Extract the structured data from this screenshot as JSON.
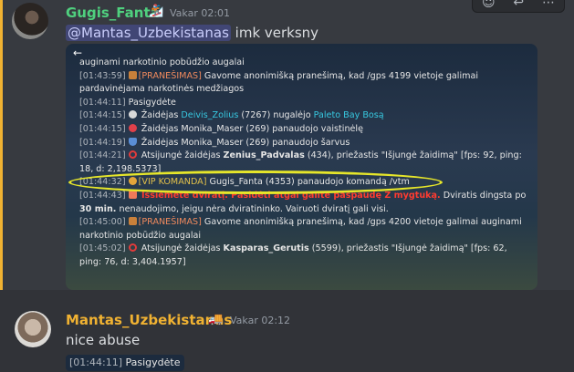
{
  "colors": {
    "highlight_border": "#f0b232",
    "author1": "#4fd07e",
    "author2": "#f0b232",
    "mention_bg": "#5865f2"
  },
  "toolbar": {
    "icons": [
      "emoji-icon",
      "reply-icon",
      "more-icon"
    ]
  },
  "message1": {
    "author": "Gugis_Fanta",
    "badge": "🏂",
    "timestamp": "Vakar 02:01",
    "mention": "@Mantas_Uzbekistanas",
    "text": " imk verksny",
    "screenshot": {
      "rows": [
        {
          "time": "",
          "parts": [
            "auginami narkotinio pobūdžio augalai"
          ]
        },
        {
          "time": "[01:43:59]",
          "tag": "[PRANEŠIMAS]",
          "text": " Gavome anonimišką pranešimą, kad /gps 4199 vietoje galimai pardavinėjama narkotinės medžiagos"
        },
        {
          "time": "[01:44:11]",
          "text": " Pasigydėte"
        },
        {
          "time": "[01:44:15]",
          "pre": " Žaidėjas ",
          "name1": "Deivis_Zolius",
          "mid": " (7267) nugalėjo ",
          "name2": "Paleto Bay Bosą"
        },
        {
          "time": "[01:44:15]",
          "text": " Žaidėjas Monika_Maser (269) panaudojo vaistinėlę"
        },
        {
          "time": "[01:44:19]",
          "text": " Žaidėjas Monika_Maser (269) panaudojo šarvus"
        },
        {
          "time": "[01:44:21]",
          "pre": " Atsijungė žaidėjas ",
          "name": "Zenius_Padvalas",
          "text": " (434), priežastis \"Išjungė žaidimą\" [fps: 92, ping: 18, d: 2,198.5373]"
        },
        {
          "time": "[01:44:32]",
          "tag": "[VIP KOMANDA]",
          "text": " Gugis_Fanta (4353) panaudojo komandą /vtm"
        },
        {
          "time": "[01:44:43]",
          "hl": " Išsiėmėte dviratį. Pasidėti atgal galite paspaudę Z mygtuką.",
          "text": " Dviratis dingsta po ",
          "bold": "30 min.",
          "text2": " nenaudojimo, jeigu nėra dviratininko. Vairuoti dviratį gali visi."
        },
        {
          "time": "[01:45:00]",
          "tag": "[PRANEŠIMAS]",
          "text": " Gavome anonimišką pranešimą, kad /gps 4200 vietoje galimai auginami narkotinio pobūdžio augalai"
        },
        {
          "time": "[01:45:02]",
          "pre": " Atsijungė žaidėjas ",
          "name": "Kasparas_Gerutis",
          "text": " (5599), priežastis \"Išjungė žaidimą\" [fps: 62, ping: 76, d: 3,404.1957]"
        }
      ]
    }
  },
  "message2": {
    "author": "Mantas_Uzbekistanas",
    "badge": "🚚",
    "timestamp": "Vakar 02:12",
    "text": "nice abuse",
    "snippet_time": "[01:44:11]",
    "snippet_text": " Pasigydėte"
  }
}
